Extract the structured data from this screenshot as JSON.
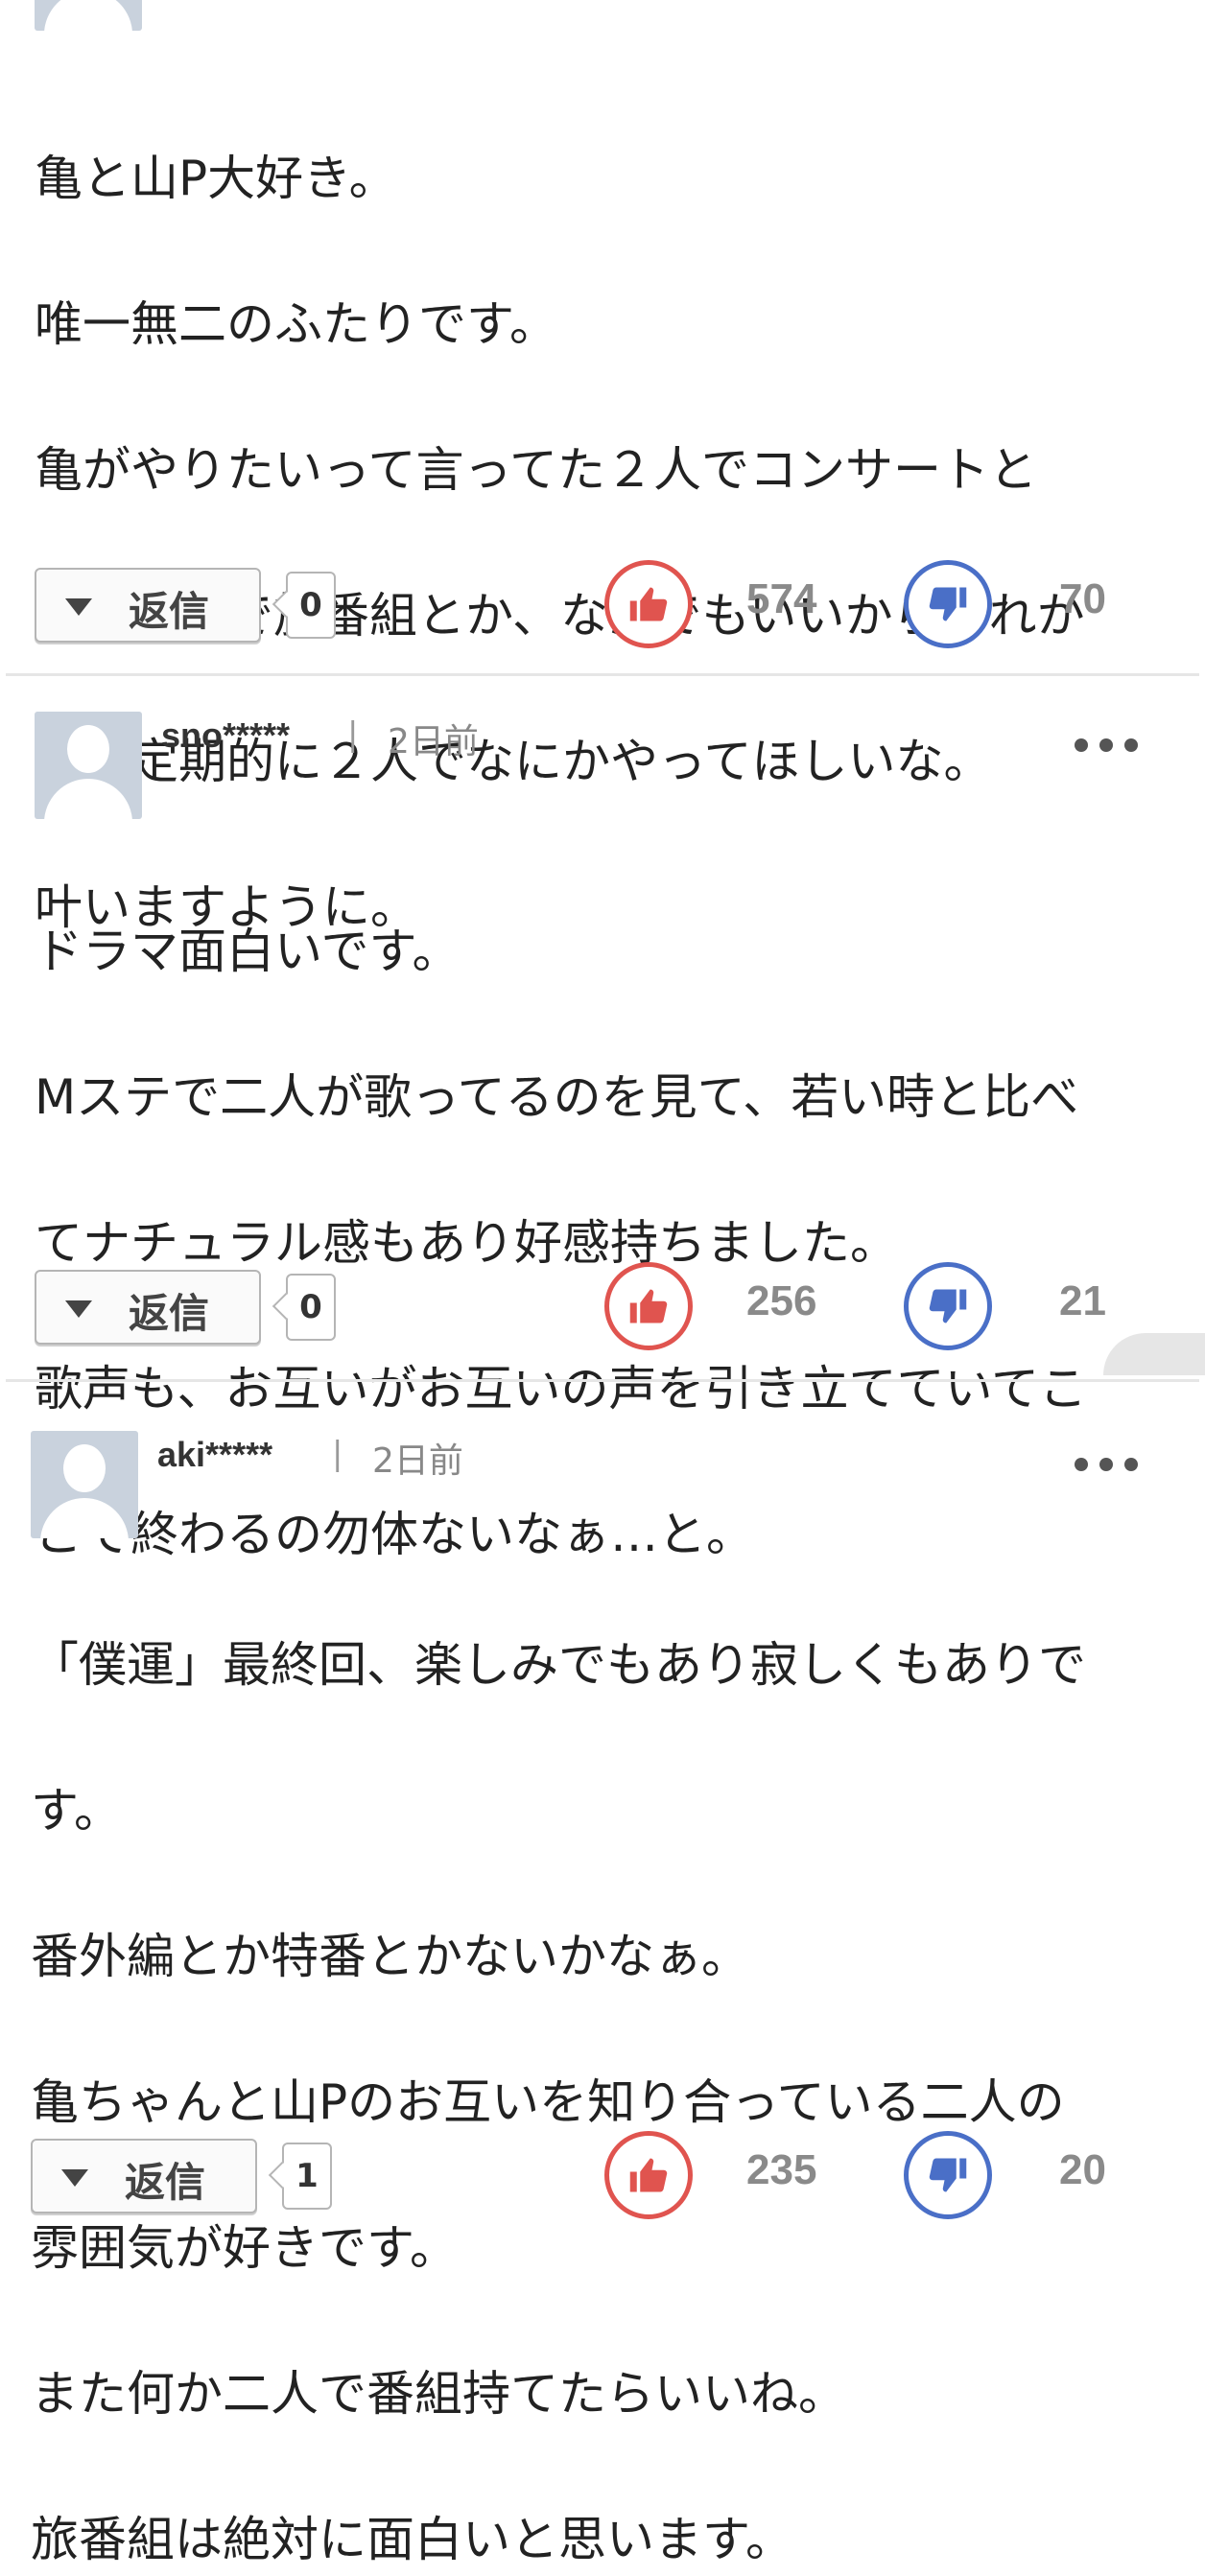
{
  "reply_label": "返信",
  "comments": [
    {
      "username": "",
      "timestamp": "",
      "lines": [
        "亀と山P大好き。",
        "唯一無二のふたりです。",
        "亀がやりたいって言ってた２人でコンサートと",
        "か、２人で旅番組とか、なんでもいいからこれか",
        "らも定期的に２人でなにかやってほしいな。",
        "叶いますように。"
      ],
      "reply_count": "0",
      "likes": "574",
      "dislikes": "70"
    },
    {
      "username": "sno*****",
      "timestamp": "2日前",
      "lines": [
        "ドラマ面白いです。",
        "Mステで二人が歌ってるのを見て、若い時と比べ",
        "てナチュラル感もあり好感持ちました。",
        "歌声も、お互いがお互いの声を引き立てていてこ",
        "こで終わるの勿体ないなぁ…と。"
      ],
      "reply_count": "0",
      "likes": "256",
      "dislikes": "21"
    },
    {
      "username": "aki*****",
      "timestamp": "2日前",
      "lines": [
        "「僕運」最終回、楽しみでもあり寂しくもありで",
        "す。",
        "番外編とか特番とかないかなぁ。",
        "亀ちゃんと山Pのお互いを知り合っている二人の",
        "雰囲気が好きです。",
        "また何か二人で番組持てたらいいね。",
        "旅番組は絶対に面白いと思います。"
      ],
      "reply_count": "1",
      "likes": "235",
      "dislikes": "20"
    }
  ],
  "colors": {
    "like": "#e0544f",
    "dislike": "#4a6fc7",
    "avatar": "#c9d2dd",
    "separator": "#e6e6e6"
  },
  "icons": {
    "like": "thumbs-up-icon",
    "dislike": "thumbs-down-icon",
    "more": "more-dots-icon",
    "caret": "caret-down-icon"
  }
}
